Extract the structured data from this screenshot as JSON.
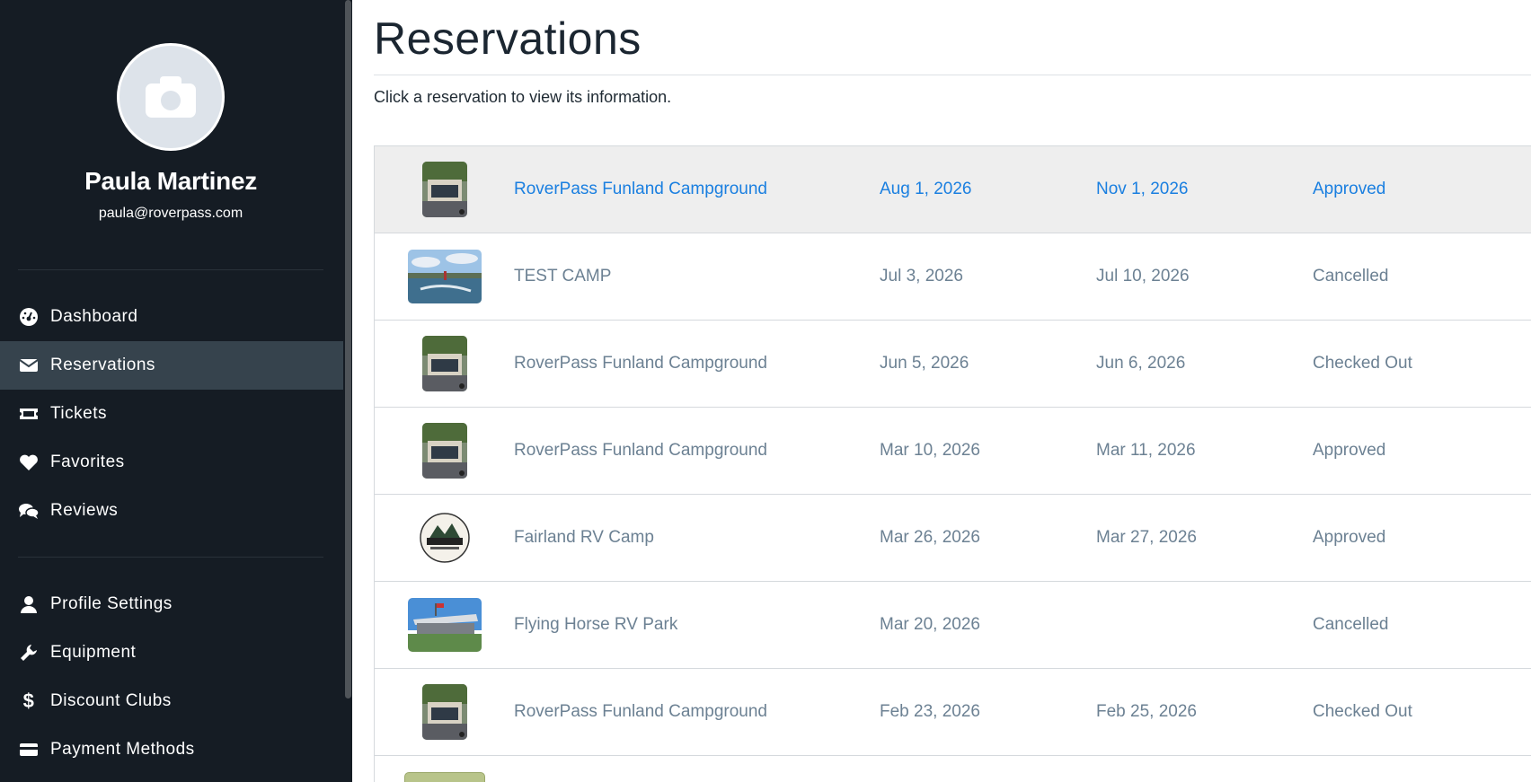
{
  "user": {
    "name": "Paula Martinez",
    "email": "paula@roverpass.com"
  },
  "nav": {
    "primary": [
      {
        "label": "Dashboard",
        "icon": "dashboard-icon"
      },
      {
        "label": "Reservations",
        "icon": "envelope-icon",
        "active": true
      },
      {
        "label": "Tickets",
        "icon": "ticket-icon"
      },
      {
        "label": "Favorites",
        "icon": "heart-icon"
      },
      {
        "label": "Reviews",
        "icon": "comments-icon"
      }
    ],
    "secondary": [
      {
        "label": "Profile Settings",
        "icon": "user-icon"
      },
      {
        "label": "Equipment",
        "icon": "wrench-icon"
      },
      {
        "label": "Discount Clubs",
        "icon": "dollar-icon"
      },
      {
        "label": "Payment Methods",
        "icon": "credit-card-icon"
      }
    ]
  },
  "page": {
    "title": "Reservations",
    "subtitle": "Click a reservation to view its information."
  },
  "colors": {
    "sidebar_bg": "#151c24",
    "active_nav_bg": "#36434d",
    "link_blue": "#1a7fe0",
    "muted_text": "#6c8193"
  },
  "reservations": [
    {
      "name": "RoverPass Funland Campground",
      "start": "Aug 1, 2026",
      "end": "Nov 1, 2026",
      "status": "Approved",
      "image": "funland-thumbnail"
    },
    {
      "name": "TEST CAMP",
      "start": "Jul 3, 2026",
      "end": "Jul 10, 2026",
      "status": "Cancelled",
      "image": "lake-thumbnail"
    },
    {
      "name": "RoverPass Funland Campground",
      "start": "Jun 5, 2026",
      "end": "Jun 6, 2026",
      "status": "Checked Out",
      "image": "funland-thumbnail"
    },
    {
      "name": "RoverPass Funland Campground",
      "start": "Mar 10, 2026",
      "end": "Mar 11, 2026",
      "status": "Approved",
      "image": "funland-thumbnail"
    },
    {
      "name": "Fairland RV Camp",
      "start": "Mar 26, 2026",
      "end": "Mar 27, 2026",
      "status": "Approved",
      "image": "fairland-logo"
    },
    {
      "name": "Flying Horse RV Park",
      "start": "Mar 20, 2026",
      "end": "",
      "status": "Cancelled",
      "image": "pavilion-thumbnail"
    },
    {
      "name": "RoverPass Funland Campground",
      "start": "Feb 23, 2026",
      "end": "Feb 25, 2026",
      "status": "Checked Out",
      "image": "funland-thumbnail"
    }
  ]
}
